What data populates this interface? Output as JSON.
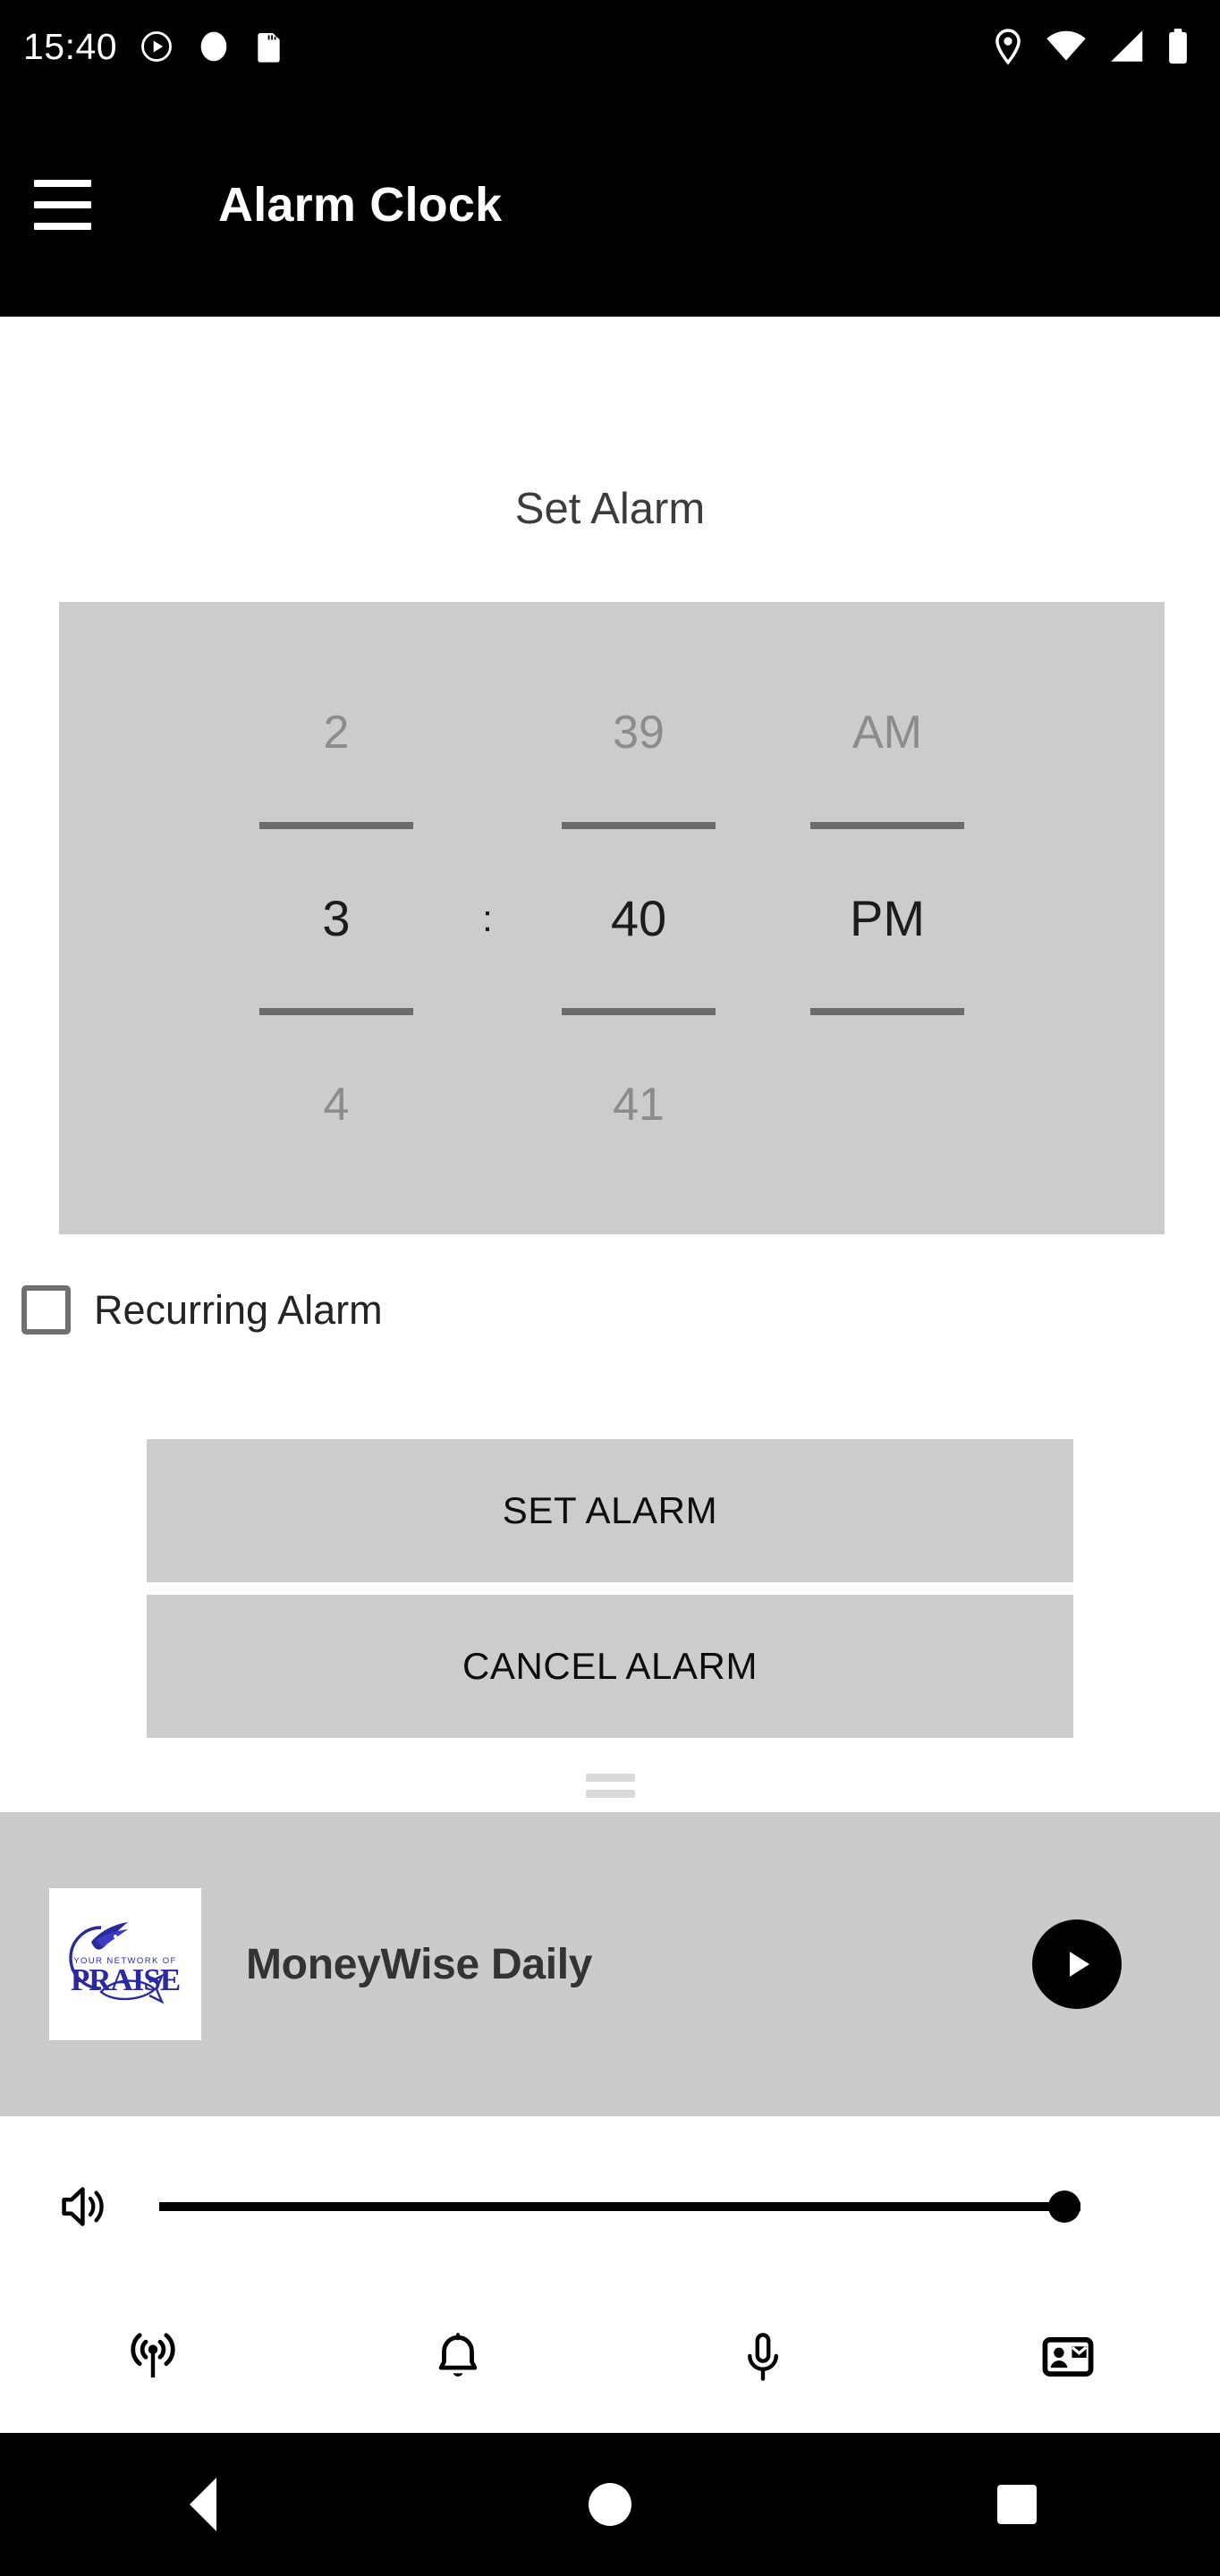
{
  "status_bar": {
    "clock": "15:40",
    "left_icons": [
      "play-circle-icon",
      "media-badge-icon",
      "sd-card-icon"
    ],
    "right_icons": [
      "location-pin-icon",
      "wifi-icon",
      "cellular-signal-icon",
      "battery-icon"
    ],
    "background": "#000000",
    "foreground": "#ffffff"
  },
  "app_bar": {
    "menu_icon": "hamburger-menu-icon",
    "title": "Alarm Clock",
    "background": "#000000"
  },
  "main": {
    "section_title": "Set Alarm",
    "time_picker": {
      "background": "#cccccc",
      "separator": ":",
      "hour": {
        "previous": "2",
        "selected": "3",
        "next": "4"
      },
      "minute": {
        "previous": "39",
        "selected": "40",
        "next": "41"
      },
      "meridiem": {
        "previous": "AM",
        "selected": "PM",
        "next": ""
      }
    },
    "recurring": {
      "label": "Recurring Alarm",
      "checked": false
    },
    "buttons": {
      "set_alarm": "SET ALARM",
      "cancel_alarm": "CANCEL ALARM",
      "background": "#cccccc"
    }
  },
  "media_player": {
    "drag_handle": "drag-handle",
    "background": "#cbcbcb",
    "album_art": {
      "name": "your-network-of-praise-logo",
      "line1": "YOUR NETWORK OF",
      "line2": "PRAISE",
      "color": "#2a2aa0"
    },
    "title": "MoneyWise Daily",
    "play_button": "play-icon",
    "volume": {
      "icon": "volume-up-icon",
      "level": 100
    }
  },
  "tab_bar": {
    "items": [
      {
        "name": "tab-live-broadcast",
        "icon": "broadcast-antenna-icon"
      },
      {
        "name": "tab-alarm",
        "icon": "bell-icon"
      },
      {
        "name": "tab-podcasts",
        "icon": "microphone-icon"
      },
      {
        "name": "tab-contact",
        "icon": "contact-card-icon"
      }
    ]
  },
  "nav_bar": {
    "background": "#000000",
    "items": [
      {
        "name": "nav-back",
        "icon": "back-triangle-icon"
      },
      {
        "name": "nav-home",
        "icon": "home-circle-icon"
      },
      {
        "name": "nav-recents",
        "icon": "recents-square-icon"
      }
    ]
  }
}
